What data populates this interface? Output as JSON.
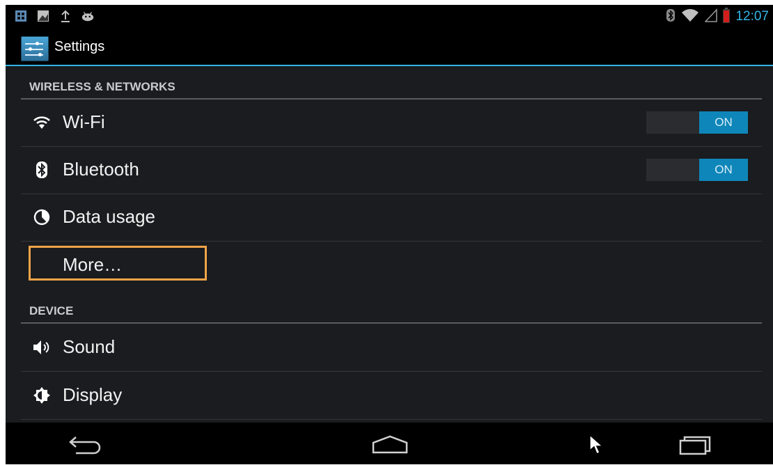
{
  "statusbar": {
    "left_icons": [
      "gallery-icon",
      "image-icon",
      "upload-icon",
      "android-icon"
    ],
    "right_icons": [
      "bluetooth-icon",
      "wifi-icon",
      "signal-icon",
      "battery-low-icon"
    ],
    "time": "12:07",
    "time_color": "#33b5e5"
  },
  "actionbar": {
    "icon": "settings-app-icon",
    "title": "Settings"
  },
  "sections": [
    {
      "title": "WIRELESS & NETWORKS",
      "items": [
        {
          "label": "Wi-Fi",
          "icon": "wifi-icon",
          "toggle": "ON"
        },
        {
          "label": "Bluetooth",
          "icon": "bluetooth-icon",
          "toggle": "ON"
        },
        {
          "label": "Data usage",
          "icon": "data-usage-icon"
        },
        {
          "label": "More…",
          "focused": true
        }
      ]
    },
    {
      "title": "DEVICE",
      "items": [
        {
          "label": "Sound",
          "icon": "speaker-icon"
        },
        {
          "label": "Display",
          "icon": "brightness-icon"
        }
      ]
    }
  ],
  "colors": {
    "accent": "#33b5e5",
    "toggle_on": "#0f86b9",
    "focus_outline": "#f0a448",
    "background": "#1a1c1f"
  },
  "navbar": {
    "buttons": [
      "back-icon",
      "home-icon",
      "cursor-icon",
      "recent-apps-icon"
    ]
  }
}
